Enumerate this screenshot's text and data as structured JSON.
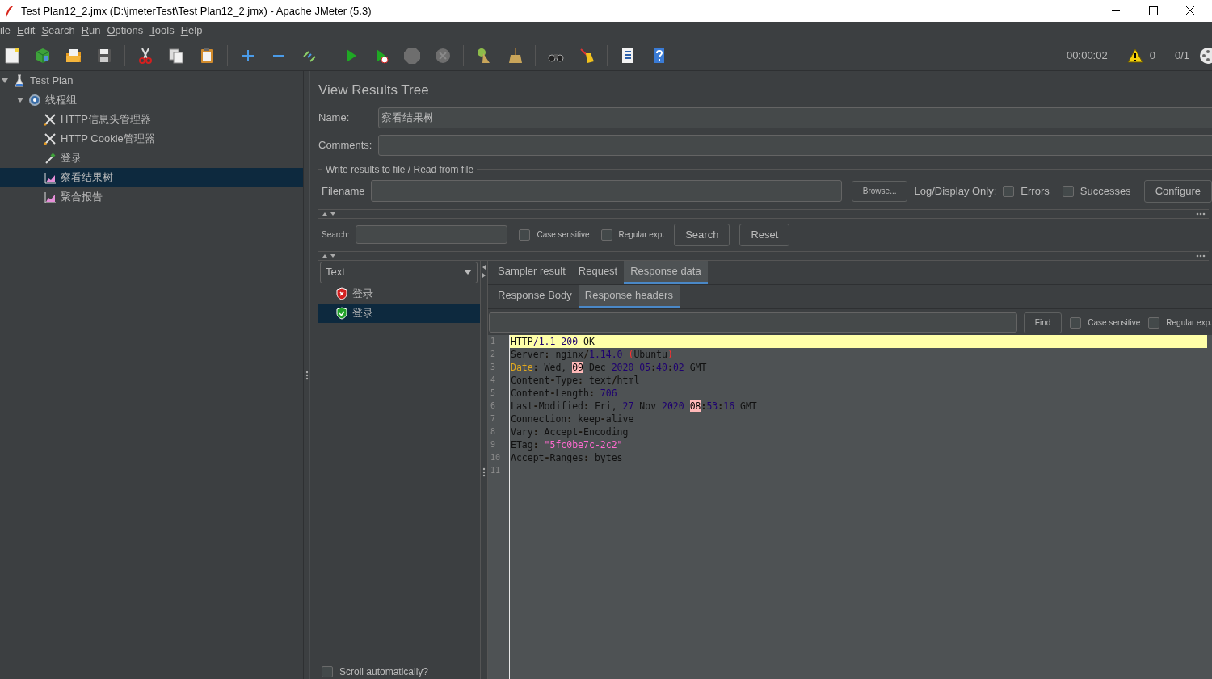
{
  "window": {
    "title": "Test Plan12_2.jmx (D:\\jmeterTest\\Test Plan12_2.jmx) - Apache JMeter (5.3)"
  },
  "menu": [
    {
      "label": "ile",
      "mnemonic": false
    },
    {
      "label": "Edit",
      "mnemonic": true
    },
    {
      "label": "Search",
      "mnemonic": true
    },
    {
      "label": "Run",
      "mnemonic": true
    },
    {
      "label": "Options",
      "mnemonic": true
    },
    {
      "label": "Tools",
      "mnemonic": true
    },
    {
      "label": "Help",
      "mnemonic": true
    }
  ],
  "toolbar_status": {
    "elapsed": "00:00:02",
    "warnings": "0",
    "threads": "0/1"
  },
  "tree": [
    {
      "label": "Test Plan",
      "kind": "plan",
      "expanded": true,
      "selected": false,
      "children": [
        {
          "label": "线程组",
          "kind": "thread-group",
          "expanded": true,
          "selected": false,
          "children": [
            {
              "label": "HTTP信息头管理器",
              "kind": "config",
              "selected": false
            },
            {
              "label": "HTTP Cookie管理器",
              "kind": "config",
              "selected": false
            },
            {
              "label": "登录",
              "kind": "sampler",
              "selected": false
            },
            {
              "label": "察看结果树",
              "kind": "listener",
              "selected": true
            },
            {
              "label": "聚合报告",
              "kind": "listener",
              "selected": false
            }
          ]
        }
      ]
    }
  ],
  "panel": {
    "title": "View Results Tree",
    "name_label": "Name:",
    "name_value": "察看结果树",
    "comments_label": "Comments:",
    "file_group": {
      "legend": "Write results to file / Read from file",
      "filename_label": "Filename",
      "browse": "Browse...",
      "log_label": "Log/Display Only:",
      "options": [
        {
          "label": "Errors",
          "checked": false
        },
        {
          "label": "Successes",
          "checked": false
        }
      ],
      "configure": "Configure"
    }
  },
  "search": {
    "label": "Search:",
    "options": [
      {
        "label": "Case sensitive",
        "checked": false
      },
      {
        "label": "Regular exp.",
        "checked": false
      }
    ],
    "buttons": [
      "Search",
      "Reset"
    ]
  },
  "results": {
    "renderer": "Text",
    "items": [
      {
        "label": "登录",
        "kind": "error",
        "selected": false
      },
      {
        "label": "登录",
        "kind": "success",
        "selected": true
      }
    ],
    "scroll_auto": {
      "label": "Scroll automatically?",
      "checked": false
    }
  },
  "tabs": [
    {
      "label": "Sampler result",
      "selected": false
    },
    {
      "label": "Request",
      "selected": false
    },
    {
      "label": "Response data",
      "selected": true
    }
  ],
  "subtabs": [
    {
      "label": "Response Body",
      "selected": false
    },
    {
      "label": "Response headers",
      "selected": true
    }
  ],
  "find": {
    "button": "Find",
    "options": [
      {
        "label": "Case sensitive",
        "checked": false
      },
      {
        "label": "Regular exp.",
        "checked": false
      }
    ]
  },
  "editor": {
    "lines": [
      {
        "number": "1",
        "highlighted": true,
        "tokens": [
          {
            "kind": "plain",
            "text": "HTTP"
          },
          {
            "kind": "num",
            "text": "/1.1 200"
          },
          {
            "kind": "plain",
            "text": " OK"
          }
        ]
      },
      {
        "number": "2",
        "highlighted": false,
        "tokens": [
          {
            "kind": "plain",
            "text": "Server"
          },
          {
            "kind": "sep",
            "text": ":"
          },
          {
            "kind": "plain",
            "text": " nginx"
          },
          {
            "kind": "sep",
            "text": "/"
          },
          {
            "kind": "num",
            "text": "1.14.0"
          },
          {
            "kind": "paren",
            "text": " ("
          },
          {
            "kind": "plain",
            "text": "Ubuntu"
          },
          {
            "kind": "paren",
            "text": ")"
          }
        ]
      },
      {
        "number": "3",
        "highlighted": false,
        "tokens": [
          {
            "kind": "kw",
            "text": "Date"
          },
          {
            "kind": "sep",
            "text": ":"
          },
          {
            "kind": "plain",
            "text": " Wed, "
          },
          {
            "kind": "match",
            "text": "09"
          },
          {
            "kind": "plain",
            "text": " Dec "
          },
          {
            "kind": "num",
            "text": "2020 05"
          },
          {
            "kind": "sep",
            "text": ":"
          },
          {
            "kind": "num",
            "text": "40"
          },
          {
            "kind": "sep",
            "text": ":"
          },
          {
            "kind": "num",
            "text": "02"
          },
          {
            "kind": "plain",
            "text": " GMT"
          }
        ]
      },
      {
        "number": "4",
        "highlighted": false,
        "tokens": [
          {
            "kind": "plain",
            "text": "Content"
          },
          {
            "kind": "sep",
            "text": "-"
          },
          {
            "kind": "plain",
            "text": "Type"
          },
          {
            "kind": "sep",
            "text": ":"
          },
          {
            "kind": "plain",
            "text": " text"
          },
          {
            "kind": "sep",
            "text": "/"
          },
          {
            "kind": "plain",
            "text": "html"
          }
        ]
      },
      {
        "number": "5",
        "highlighted": false,
        "tokens": [
          {
            "kind": "plain",
            "text": "Content"
          },
          {
            "kind": "sep",
            "text": "-"
          },
          {
            "kind": "plain",
            "text": "Length"
          },
          {
            "kind": "sep",
            "text": ":"
          },
          {
            "kind": "num",
            "text": " 706"
          }
        ]
      },
      {
        "number": "6",
        "highlighted": false,
        "tokens": [
          {
            "kind": "plain",
            "text": "Last"
          },
          {
            "kind": "sep",
            "text": "-"
          },
          {
            "kind": "plain",
            "text": "Modified"
          },
          {
            "kind": "sep",
            "text": ":"
          },
          {
            "kind": "plain",
            "text": " Fri, "
          },
          {
            "kind": "num",
            "text": "27"
          },
          {
            "kind": "plain",
            "text": " Nov "
          },
          {
            "kind": "num",
            "text": "2020 "
          },
          {
            "kind": "match",
            "text": "08"
          },
          {
            "kind": "sep",
            "text": ":"
          },
          {
            "kind": "num",
            "text": "53"
          },
          {
            "kind": "sep",
            "text": ":"
          },
          {
            "kind": "num",
            "text": "16"
          },
          {
            "kind": "plain",
            "text": " GMT"
          }
        ]
      },
      {
        "number": "7",
        "highlighted": false,
        "tokens": [
          {
            "kind": "plain",
            "text": "Connection"
          },
          {
            "kind": "sep",
            "text": ":"
          },
          {
            "kind": "plain",
            "text": " keep"
          },
          {
            "kind": "sep",
            "text": "-"
          },
          {
            "kind": "plain",
            "text": "alive"
          }
        ]
      },
      {
        "number": "8",
        "highlighted": false,
        "tokens": [
          {
            "kind": "plain",
            "text": "Vary"
          },
          {
            "kind": "sep",
            "text": ":"
          },
          {
            "kind": "plain",
            "text": " Accept"
          },
          {
            "kind": "sep",
            "text": "-"
          },
          {
            "kind": "plain",
            "text": "Encoding"
          }
        ]
      },
      {
        "number": "9",
        "highlighted": false,
        "tokens": [
          {
            "kind": "plain",
            "text": "ETag"
          },
          {
            "kind": "sep",
            "text": ":"
          },
          {
            "kind": "str",
            "text": " \"5fc0be7c-2c2\""
          }
        ]
      },
      {
        "number": "10",
        "highlighted": false,
        "tokens": [
          {
            "kind": "plain",
            "text": "Accept"
          },
          {
            "kind": "sep",
            "text": "-"
          },
          {
            "kind": "plain",
            "text": "Ranges"
          },
          {
            "kind": "sep",
            "text": ":"
          },
          {
            "kind": "plain",
            "text": " bytes"
          }
        ]
      },
      {
        "number": "11",
        "highlighted": false
      }
    ]
  }
}
